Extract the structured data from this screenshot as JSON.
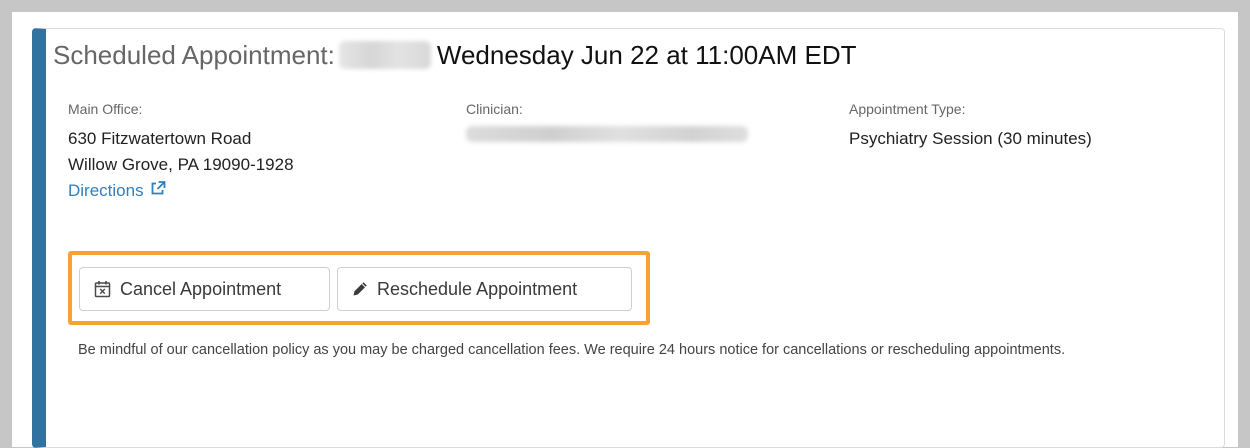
{
  "appointment": {
    "title_prefix": "Scheduled Appointment:",
    "title_datetime": "Wednesday Jun 22 at 11:00AM EDT"
  },
  "office": {
    "label": "Main Office:",
    "address_line1": "630 Fitzwatertown Road",
    "address_line2": "Willow Grove, PA 19090-1928",
    "directions_label": "Directions"
  },
  "clinician": {
    "label": "Clinician:"
  },
  "appointment_type": {
    "label": "Appointment Type:",
    "value": "Psychiatry Session (30 minutes)"
  },
  "actions": {
    "cancel_label": "Cancel Appointment",
    "reschedule_label": "Reschedule Appointment"
  },
  "policy_note": "Be mindful of our cancellation policy as you may be charged cancellation fees. We require 24 hours notice for cancellations or rescheduling appointments.",
  "icons": {
    "cancel": "calendar-x-icon",
    "reschedule": "pencil-icon",
    "directions": "external-link-icon"
  },
  "colors": {
    "accent_bar": "#33719f",
    "link": "#2f7fc1",
    "highlight": "#f7a233"
  }
}
